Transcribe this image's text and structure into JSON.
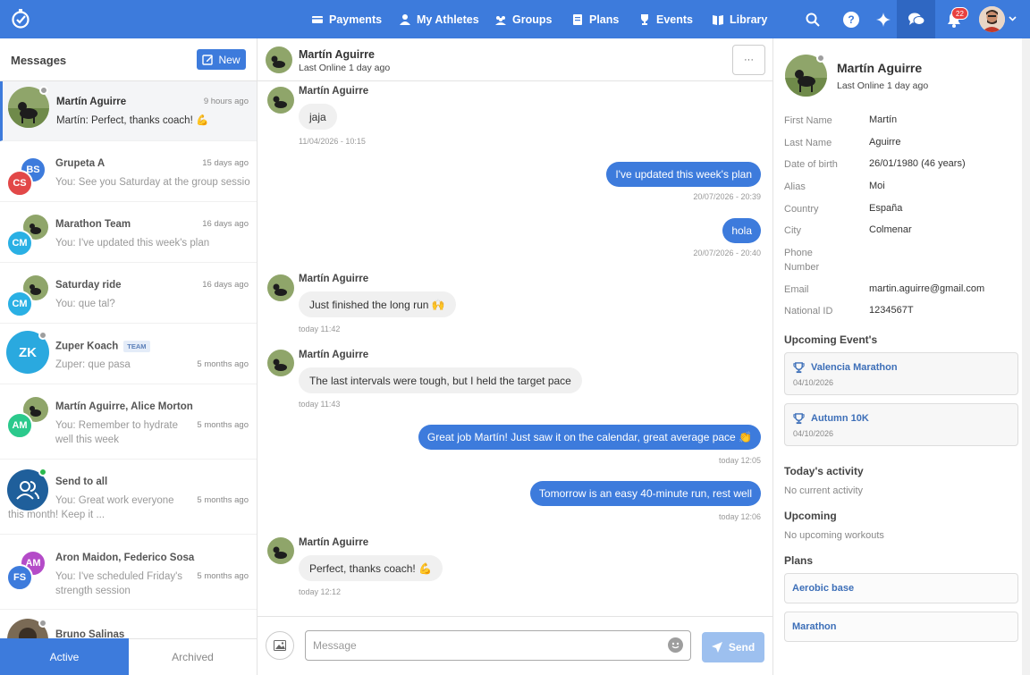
{
  "nav": {
    "items": [
      {
        "label": "Payments",
        "icon": "payments-icon"
      },
      {
        "label": "My Athletes",
        "icon": "athlete-icon"
      },
      {
        "label": "Groups",
        "icon": "groups-icon"
      },
      {
        "label": "Plans",
        "icon": "plans-icon"
      },
      {
        "label": "Events",
        "icon": "trophy-icon"
      },
      {
        "label": "Library",
        "icon": "library-icon"
      }
    ],
    "help_label": "?",
    "notification_count": "22",
    "accent": "#3d7bdc"
  },
  "sidebar": {
    "title": "Messages",
    "new_label": "New",
    "conversations": [
      {
        "name": "Martín Aguirre",
        "time": "9 hours ago",
        "preview": "Martín: Perfect, thanks coach! 💪"
      },
      {
        "name": "Grupeta A",
        "time": "15 days ago",
        "preview": "You: See you Saturday at the group session...",
        "initials": [
          "BS",
          "CS"
        ]
      },
      {
        "name": "Marathon Team",
        "time": "16 days ago",
        "preview": "You: I've updated this week's plan",
        "initials": [
          "CM"
        ]
      },
      {
        "name": "Saturday ride",
        "time": "16 days ago",
        "preview": "You: que tal?",
        "initials": [
          "CM"
        ]
      },
      {
        "name": "Zuper Koach",
        "tag": "TEAM",
        "time": "5 months ago",
        "preview": "Zuper: que pasa",
        "initials": [
          "ZK"
        ]
      },
      {
        "name": "Martín Aguirre, Alice Morton",
        "time": "5 months ago",
        "preview": "You: Remember to hydrate well this week",
        "initials": [
          "AM"
        ]
      },
      {
        "name": "Send to all",
        "time": "5 months ago",
        "preview": "You: Great work everyone this month! Keep it ..."
      },
      {
        "name": "Aron Maidon, Federico Sosa",
        "time": "5 months ago",
        "preview": "You: I've scheduled Friday's strength session",
        "initials": [
          "AM",
          "FS"
        ]
      },
      {
        "name": "Bruno Salinas"
      }
    ],
    "tabs": {
      "active": "Active",
      "archived": "Archived"
    }
  },
  "chat": {
    "name": "Martín Aguirre",
    "online": "Last Online 1 day ago",
    "more_label": "···",
    "messages": [
      {
        "author": "Martín Aguirre",
        "text": "jaja",
        "time": "11/04/2026 - 10:15"
      },
      {
        "text": "I've updated this week's plan",
        "time": "20/07/2026 - 20:39"
      },
      {
        "text": "hola",
        "time": "20/07/2026 - 20:40"
      },
      {
        "author": "Martín Aguirre",
        "text": "Just finished the long run 🙌",
        "time": "today 11:42"
      },
      {
        "author": "Martín Aguirre",
        "text": "The last intervals were tough, but I held the target pace",
        "time": "today 11:43"
      },
      {
        "text": "Great job Martín! Just saw it on the calendar, great average pace 👏",
        "time": "today 12:05"
      },
      {
        "text": "Tomorrow is an easy 40-minute run, rest well",
        "time": "today 12:06"
      },
      {
        "author": "Martín Aguirre",
        "text": "Perfect, thanks coach! 💪",
        "time": "today 12:12"
      }
    ],
    "input_placeholder": "Message",
    "send_label": "Send"
  },
  "profile": {
    "name": "Martín Aguirre",
    "online": "Last Online 1 day ago",
    "fields": [
      {
        "label": "First Name",
        "value": "Martín"
      },
      {
        "label": "Last Name",
        "value": "Aguirre"
      },
      {
        "label": "Date of birth",
        "value": "26/01/1980 (46 years)"
      },
      {
        "label": "Alias",
        "value": "Moi"
      },
      {
        "label": "Country",
        "value": "España"
      },
      {
        "label": "City",
        "value": "Colmenar"
      },
      {
        "label": "Phone Number",
        "value": ""
      },
      {
        "label": "Email",
        "value": "martin.aguirre@gmail.com"
      },
      {
        "label": "National ID",
        "value": "1234567T"
      }
    ],
    "events_title": "Upcoming Event's",
    "events": [
      {
        "title": "Valencia Marathon",
        "date": "04/10/2026"
      },
      {
        "title": "Autumn 10K",
        "date": "04/10/2026"
      }
    ],
    "activity_title": "Today's activity",
    "activity_text": "No current activity",
    "upcoming_title": "Upcoming",
    "upcoming_text": "No upcoming workouts",
    "plans_title": "Plans",
    "plans": [
      "Aerobic base",
      "Marathon"
    ]
  }
}
